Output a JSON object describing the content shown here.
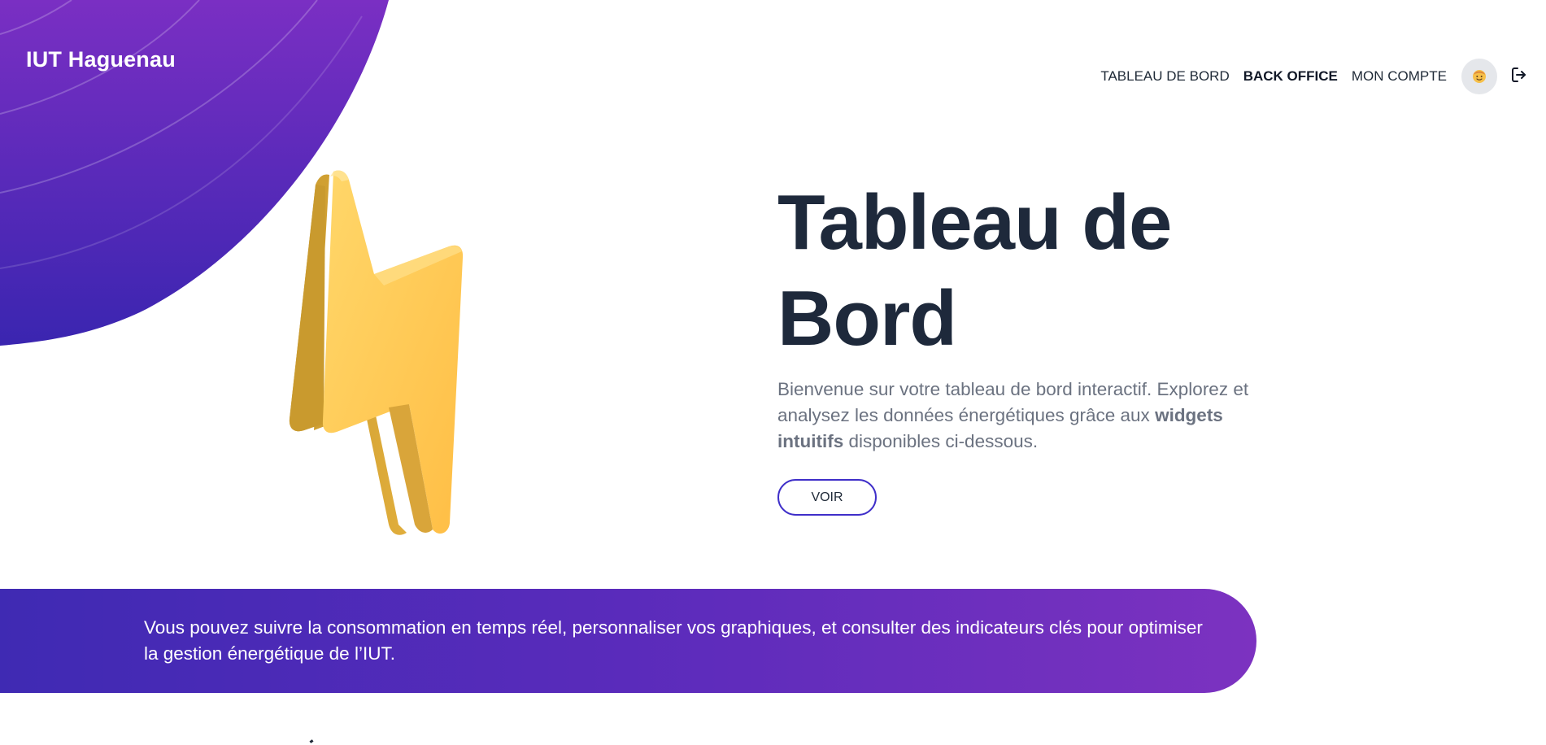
{
  "header": {
    "brand": "IUT Haguenau",
    "nav": [
      {
        "label": "TABLEAU DE BORD",
        "active": false
      },
      {
        "label": "BACK OFFICE",
        "active": true
      },
      {
        "label": "MON COMPTE",
        "active": false
      }
    ],
    "avatar_icon": "avatar-emoji-icon",
    "logout_icon": "logout-icon"
  },
  "hero": {
    "title": "Tableau de Bord",
    "description_part1": "Bienvenue sur votre tableau de bord interactif. Explorez et analysez les données énergétiques grâce aux ",
    "description_bold": "widgets intuitifs",
    "description_part2": " disponibles ci-dessous.",
    "cta_label": "VOIR",
    "illustration": "lightning-bolt-icon"
  },
  "banner": {
    "text": "Vous pouvez suivre la consommation en temps réel, personnaliser vos graphiques, et consulter des indicateurs clés pour optimiser la gestion énergétique de l’IUT."
  },
  "colors": {
    "accent_start": "#3f2ab3",
    "accent_end": "#7c32c0",
    "bolt": "#ffc64d",
    "title": "#1e293b",
    "muted_text": "#6b7280"
  }
}
